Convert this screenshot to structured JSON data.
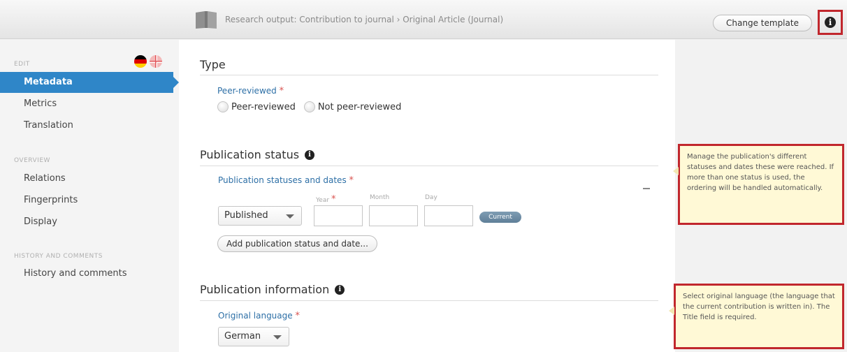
{
  "header": {
    "breadcrumb": "Research output: Contribution to journal › Original Article (Journal)",
    "change_template_label": "Change template",
    "info_icon": "info-icon"
  },
  "sidebar": {
    "edit_heading": "EDIT",
    "edit_items": [
      {
        "label": "Metadata",
        "active": true
      },
      {
        "label": "Metrics"
      },
      {
        "label": "Translation"
      }
    ],
    "overview_heading": "OVERVIEW",
    "overview_items": [
      {
        "label": "Relations"
      },
      {
        "label": "Fingerprints"
      },
      {
        "label": "Display"
      }
    ],
    "history_heading": "HISTORY AND COMMENTS",
    "history_items": [
      {
        "label": "History and comments"
      }
    ],
    "flags": [
      "german-flag-icon",
      "english-flag-icon"
    ]
  },
  "main": {
    "type_section": {
      "title": "Type",
      "field_label": "Peer-reviewed",
      "required_mark": "*",
      "options": [
        "Peer-reviewed",
        "Not peer-reviewed"
      ]
    },
    "status_section": {
      "title": "Publication status",
      "field_label": "Publication statuses and dates",
      "required_mark": "*",
      "status_value": "Published",
      "year_label": "Year",
      "month_label": "Month",
      "day_label": "Day",
      "year_value": "",
      "month_value": "",
      "day_value": "",
      "current_badge": "Current",
      "add_button_label": "Add publication status and date..."
    },
    "info_section": {
      "title": "Publication information",
      "field_label": "Original language",
      "required_mark": "*",
      "language_value": "German"
    }
  },
  "tooltips": {
    "status_tip": "Manage the publication's different statuses and dates these were reached. If more than one status is used, the ordering will be handled automatically.",
    "language_tip": "Select original language (the language that the current contribution is written in). The Title field is required."
  },
  "colors": {
    "accent": "#2f86c8",
    "required": "#d9534f",
    "highlight_border": "#c1272d",
    "tooltip_bg": "#fff9d6"
  }
}
